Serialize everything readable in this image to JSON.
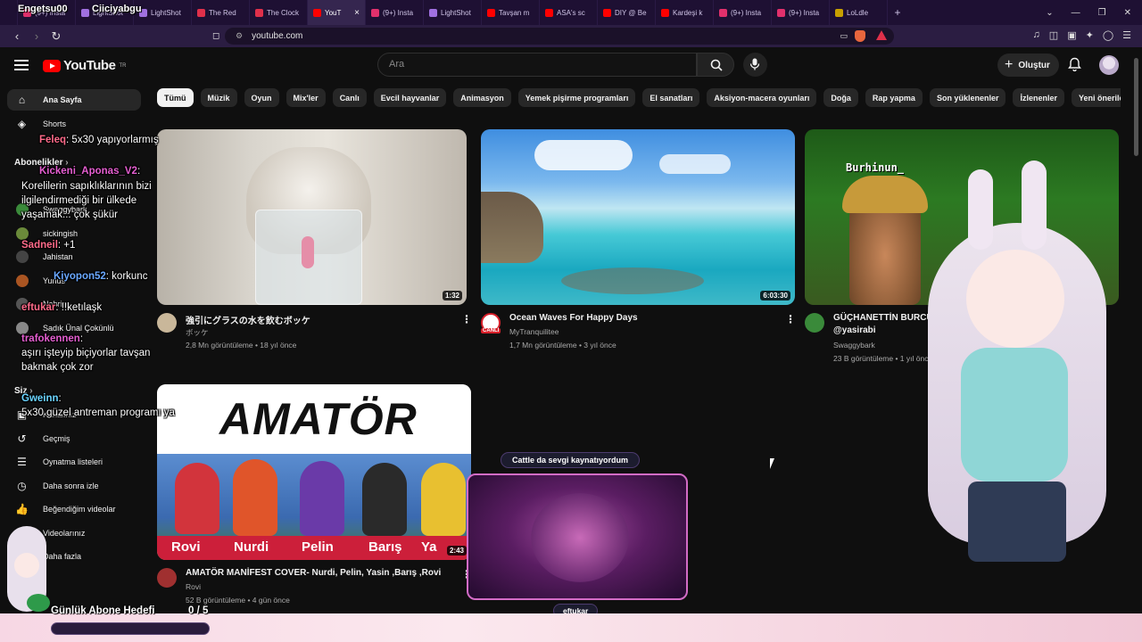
{
  "browser": {
    "stream_labels": {
      "a": "Engetsu00",
      "b": "Ciiciyabgu"
    },
    "tabs": [
      {
        "label": "(9+) Insta",
        "color": "#e1306c"
      },
      {
        "label": "LightShot",
        "color": "#a070e0"
      },
      {
        "label": "LightShot",
        "color": "#a070e0"
      },
      {
        "label": "The Red",
        "color": "#e0304a"
      },
      {
        "label": "The Clock",
        "color": "#e0304a"
      },
      {
        "label": "YouT",
        "color": "#ff0000",
        "active": true
      },
      {
        "label": "(9+) Insta",
        "color": "#e1306c"
      },
      {
        "label": "LightShot",
        "color": "#a070e0"
      },
      {
        "label": "Tavşan m",
        "color": "#ff0000"
      },
      {
        "label": "ASA's sc",
        "color": "#ff0000"
      },
      {
        "label": "DIY @ Be",
        "color": "#ff0000"
      },
      {
        "label": "Kardeşi k",
        "color": "#ff0000"
      },
      {
        "label": "(9+) Insta",
        "color": "#e1306c"
      },
      {
        "label": "(9+) Insta",
        "color": "#e1306c"
      },
      {
        "label": "LoLdle",
        "color": "#c8a000"
      }
    ],
    "new_tab": "+",
    "url": "youtube.com"
  },
  "header": {
    "logo": "YouTube",
    "region": "TR",
    "search_placeholder": "Ara",
    "create_label": "Oluştur"
  },
  "sidebar": {
    "main": [
      {
        "label": "Ana Sayfa",
        "icon": "home-icon",
        "active": true
      },
      {
        "label": "Shorts",
        "icon": "shorts-icon"
      }
    ],
    "subs_title": "Abonelikler",
    "subs": [
      {
        "label": "Swaggybark",
        "color": "#3a8a3a"
      },
      {
        "label": "sickingish",
        "color": "#6a8a3a"
      },
      {
        "label": "Jahistan",
        "color": "#444"
      },
      {
        "label": "Yunus",
        "color": "#aa5522"
      },
      {
        "label": "Nahrin",
        "color": "#555"
      },
      {
        "label": "Sadık Ünal Çokünlü",
        "color": "#888"
      }
    ],
    "you_title": "Siz",
    "you": [
      {
        "label": "Kanalınız",
        "icon": "channel-icon"
      },
      {
        "label": "Geçmiş",
        "icon": "history-icon"
      },
      {
        "label": "Oynatma listeleri",
        "icon": "playlist-icon"
      },
      {
        "label": "Daha sonra izle",
        "icon": "clock-icon"
      },
      {
        "label": "Beğendiğim videolar",
        "icon": "like-icon"
      },
      {
        "label": "Videolarınız",
        "icon": "video-icon"
      },
      {
        "label": "Daha fazla",
        "icon": "chevron-down-icon"
      }
    ]
  },
  "chips": [
    "Tümü",
    "Müzik",
    "Oyun",
    "Mix'ler",
    "Canlı",
    "Evcil hayvanlar",
    "Animasyon",
    "Yemek pişirme programları",
    "El sanatları",
    "Aksiyon-macera oyunları",
    "Doğa",
    "Rap yapma",
    "Son yüklenenler",
    "İzlenenler",
    "Yeni öneriler"
  ],
  "videos": [
    {
      "title": "強引にグラスの水を飲むボッケ",
      "channel": "ボッケ",
      "meta": "2,8 Mn görüntüleme • 18 yıl önce",
      "duration": "1:32",
      "avatar": "#c9b79a"
    },
    {
      "title": "Ocean Waves For Happy Days",
      "channel": "MyTranquilitee",
      "meta": "1,7 Mn görüntüleme • 3 yıl önce",
      "duration": "6:03:30",
      "avatar": "#d8202a",
      "live_badge": "CANLI"
    },
    {
      "title": "GÜÇHANETTİN BURCUL",
      "title2": "@yasirabi",
      "channel": "Swaggybark",
      "meta": "23 B görüntüleme • 1 yıl önce",
      "duration": "",
      "avatar": "#3a8a3a",
      "thumb_text": "Burhinun_"
    },
    {
      "title": "AMATÖR MANİFEST COVER- Nurdi, Pelin, Yasin ,Barış ,Rovi",
      "channel": "Rovi",
      "meta": "52 B görüntüleme • 4 gün önce",
      "duration": "2:43",
      "avatar": "#a03030",
      "thumb_text": "AMATÖR",
      "names": [
        "Rovi",
        "Nurdi",
        "Pelin",
        "Barış",
        "Ya"
      ]
    }
  ],
  "chat": [
    {
      "user": "Feleq",
      "color": "#ff6b8a",
      "text": ": 5x30 yapıyorlarmış"
    },
    {
      "user": "Kickeni_Aponas_V2",
      "color": "#e45ed0",
      "text": ":"
    },
    {
      "user": "",
      "color": "#fff",
      "text": "Korelilerin sapıklıklarının bizi"
    },
    {
      "user": "",
      "color": "#fff",
      "text": "ilgilendirmediği bir ülkede"
    },
    {
      "user": "",
      "color": "#fff",
      "text": "yaşamak... çok şükür"
    },
    {
      "user": "Sadneil",
      "color": "#ff6b8a",
      "text": ": +1"
    },
    {
      "user": "Kiyopon52",
      "color": "#6aa8ff",
      "text": ": korkunc"
    },
    {
      "user": "eftukar",
      "color": "#ff6b8a",
      "text": ": !!ketılaşk"
    },
    {
      "user": "trafokennen",
      "color": "#e45ed0",
      "text": ":"
    },
    {
      "user": "",
      "color": "#fff",
      "text": "aşırı işteyip biçiyorlar tavşan"
    },
    {
      "user": "",
      "color": "#fff",
      "text": "bakmak çok zor"
    },
    {
      "user": "Gweinn",
      "color": "#6ad4ff",
      "text": ":"
    },
    {
      "user": "",
      "color": "#fff",
      "text": "5x30 güzel antreman programı ya"
    }
  ],
  "overlay": {
    "top_bubble": "Cattle da sevgi kaynatıyordum",
    "bottom_bubble": "eftukar",
    "goal_label": "Günlük Abone Hedefi",
    "goal_count": "0 / 5",
    "goal_fraction": 0
  },
  "colors": {
    "accent": "#ff0000",
    "bg": "#0f0f0f",
    "chip": "#272727"
  }
}
